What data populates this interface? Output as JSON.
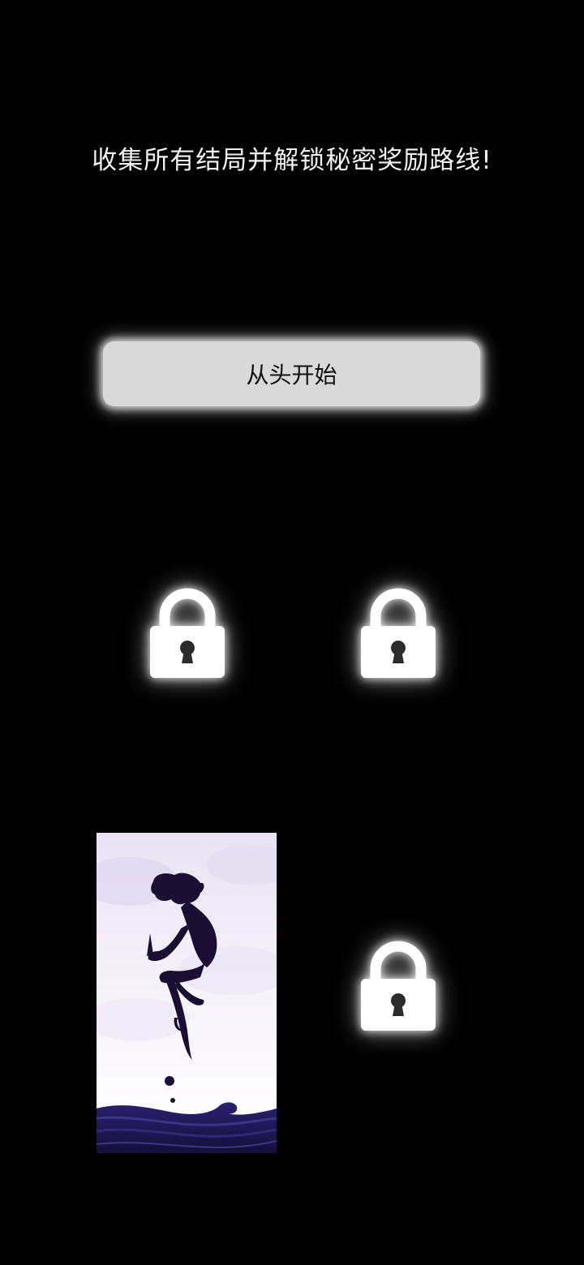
{
  "headline": "收集所有结局并解锁秘密奖励路线!",
  "restart_button": {
    "label": "从头开始"
  },
  "endings": [
    {
      "state": "locked",
      "icon": "padlock-icon"
    },
    {
      "state": "locked",
      "icon": "padlock-icon"
    },
    {
      "state": "unlocked",
      "icon": "ending-thumbnail"
    },
    {
      "state": "locked",
      "icon": "padlock-icon"
    }
  ],
  "colors": {
    "background": "#000000",
    "button_fill": "#d9d9d9",
    "lock_fill": "#ffffff",
    "silhouette": "#1a0f33",
    "sky_top": "#ece6f5",
    "wave": "#231a5c"
  }
}
